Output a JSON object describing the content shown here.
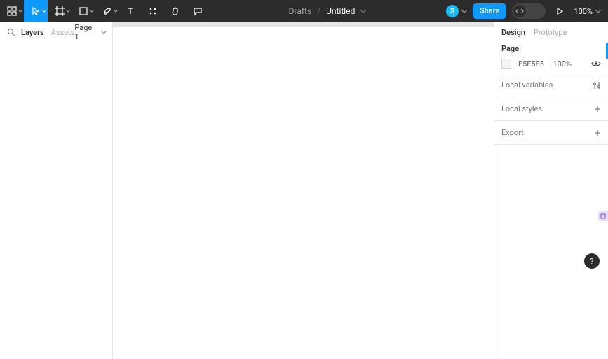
{
  "toolbar": {
    "tools": [
      "main-menu",
      "move",
      "frame",
      "shape",
      "pen",
      "text",
      "resources",
      "hand",
      "comment"
    ]
  },
  "breadcrumb": {
    "parent": "Drafts",
    "title": "Untitled"
  },
  "header": {
    "avatar_initial": "S",
    "share_label": "Share",
    "zoom_label": "100%"
  },
  "left_panel": {
    "tabs": [
      "Layers",
      "Assets"
    ],
    "active_tab": 0,
    "page_label": "Page 1"
  },
  "right_panel": {
    "tabs": [
      "Design",
      "Prototype"
    ],
    "active_tab": 0,
    "page_section_label": "Page",
    "background_hex": "F5F5F5",
    "background_opacity": "100%",
    "rows": [
      {
        "label": "Local variables",
        "icon": "sliders"
      },
      {
        "label": "Local styles",
        "icon": "plus"
      },
      {
        "label": "Export",
        "icon": "plus"
      }
    ]
  },
  "help_label": "?"
}
